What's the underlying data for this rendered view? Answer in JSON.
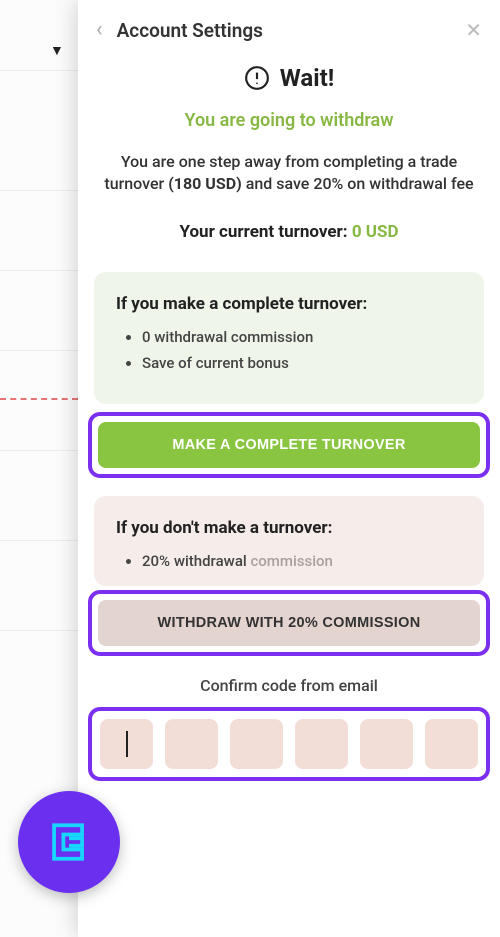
{
  "header": {
    "title": "Account Settings"
  },
  "alert": {
    "wait": "Wait!",
    "subtitle": "You are going to withdraw",
    "body_pre": "You are one step away from completing a trade turnover ",
    "body_bold": "(180 USD)",
    "body_post": " and save 20% on withdrawal fee",
    "current_label": "Your current turnover: ",
    "current_value": "0 USD"
  },
  "green_card": {
    "title": "If you make a complete turnover:",
    "bullets": [
      "0 withdrawal commission",
      "Save of current bonus"
    ],
    "button": "MAKE A COMPLETE TURNOVER"
  },
  "pink_card": {
    "title": "If you don't make a turnover:",
    "bullet_text": "20% withdrawal ",
    "bullet_muted": "commission",
    "button": "WITHDRAW WITH 20% COMMISSION"
  },
  "confirm": {
    "label": "Confirm code from email"
  }
}
